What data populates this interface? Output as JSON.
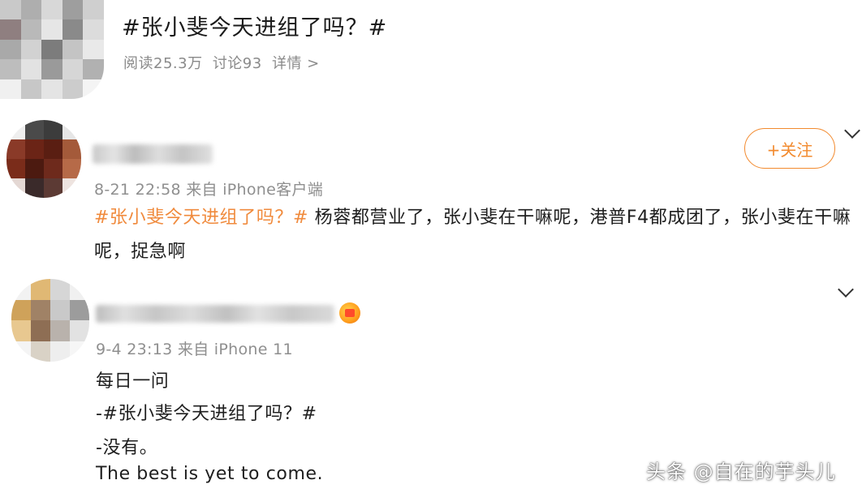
{
  "topic": {
    "title": "#张小斐今天进组了吗？#",
    "reads": "阅读25.3万",
    "discussions": "讨论93",
    "details": "详情 >"
  },
  "comment1": {
    "meta": "8-21 22:58  来自 iPhone客户端",
    "follow_label": "+关注",
    "hashtag": "#张小斐今天进组了吗？#",
    "text": " 杨蓉都营业了，张小斐在干嘛呢，港普F4都成团了，张小斐在干嘛呢，捉急啊"
  },
  "comment2": {
    "meta": "9-4 23:13  来自 iPhone 11",
    "line1": "每日一问",
    "line2": "-#张小斐今天进组了吗？#",
    "line3": "-没有。",
    "line4": "The best is yet to come."
  },
  "watermark": "头条 @自在的芋头儿",
  "colors": {
    "accent": "#f08a3c",
    "meta_gray": "#8f8f8f",
    "text": "#1e1e1e"
  }
}
